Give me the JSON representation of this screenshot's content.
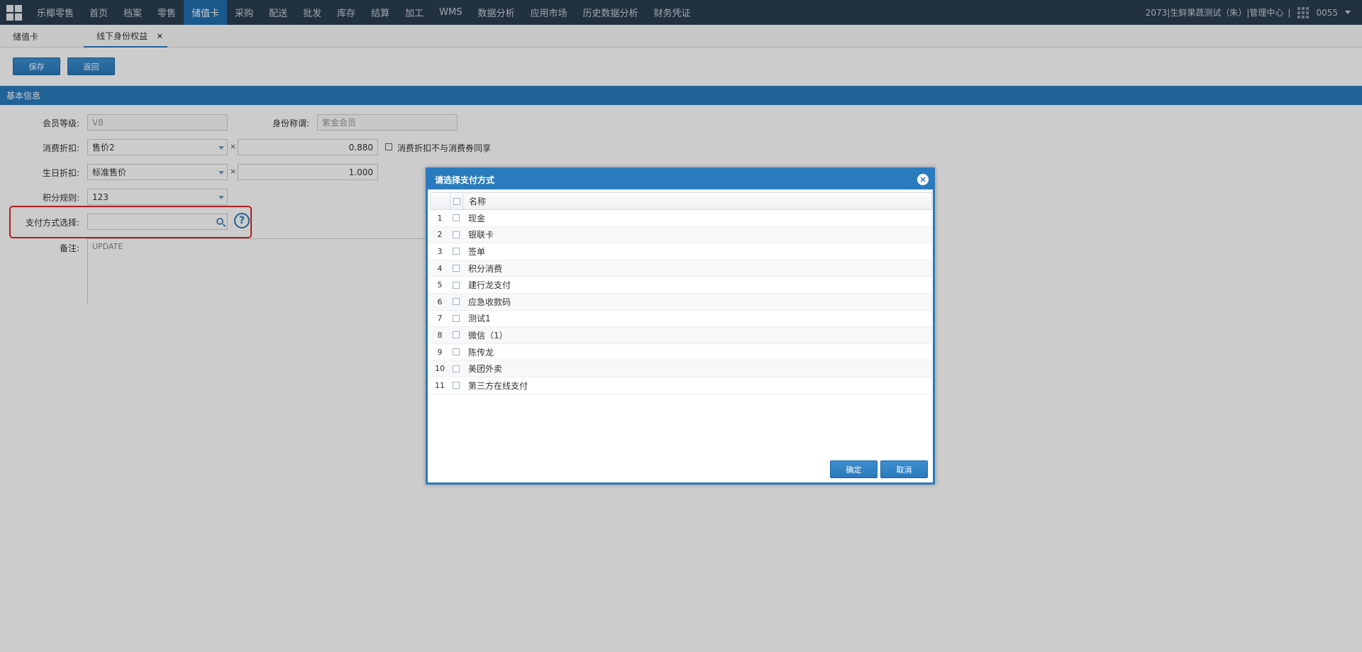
{
  "nav": {
    "items": [
      "乐椰零售",
      "首页",
      "档案",
      "零售",
      "储值卡",
      "采购",
      "配送",
      "批发",
      "库存",
      "结算",
      "加工",
      "WMS",
      "数据分析",
      "应用市场",
      "历史数据分析",
      "财务凭证"
    ],
    "active_index": 4,
    "user": "2073|生鲜果蔬测试（朱）|管理中心",
    "separator": "|",
    "account": "0055"
  },
  "tabs": {
    "tab1": "储值卡",
    "tab2": "线下身份权益",
    "close": "×"
  },
  "toolbar": {
    "save": "保存",
    "back": "返回"
  },
  "section": {
    "title": "基本信息"
  },
  "form": {
    "member_level_label": "会员等级:",
    "member_level_value": "V8",
    "identity_label": "身份称谓:",
    "identity_value": "紫金会员",
    "discount_label": "消费折扣:",
    "discount_select": "售价2",
    "discount_times": "×",
    "discount_value": "0.880",
    "discount_exclusive_label": "消费折扣不与消费券同享",
    "birthday_label": "生日折扣:",
    "birthday_select": "标准售价",
    "birthday_times": "×",
    "birthday_value": "1.000",
    "points_label": "积分规则:",
    "points_select": "123",
    "payment_label": "支付方式选择:",
    "payment_value": "",
    "help": "?",
    "remark_label": "备注:",
    "remark_value": "UPDATE"
  },
  "dialog": {
    "title": "请选择支付方式",
    "close": "×",
    "column_name": "名称",
    "rows": [
      {
        "num": "1",
        "name": "现金"
      },
      {
        "num": "2",
        "name": "银联卡"
      },
      {
        "num": "3",
        "name": "签单"
      },
      {
        "num": "4",
        "name": "积分消费"
      },
      {
        "num": "5",
        "name": "建行龙支付"
      },
      {
        "num": "6",
        "name": "应急收款码"
      },
      {
        "num": "7",
        "name": "测试1"
      },
      {
        "num": "8",
        "name": "微信（1）"
      },
      {
        "num": "9",
        "name": "陈传龙"
      },
      {
        "num": "10",
        "name": "美团外卖"
      },
      {
        "num": "11",
        "name": "第三方在线支付"
      }
    ],
    "ok": "确定",
    "cancel": "取消"
  }
}
